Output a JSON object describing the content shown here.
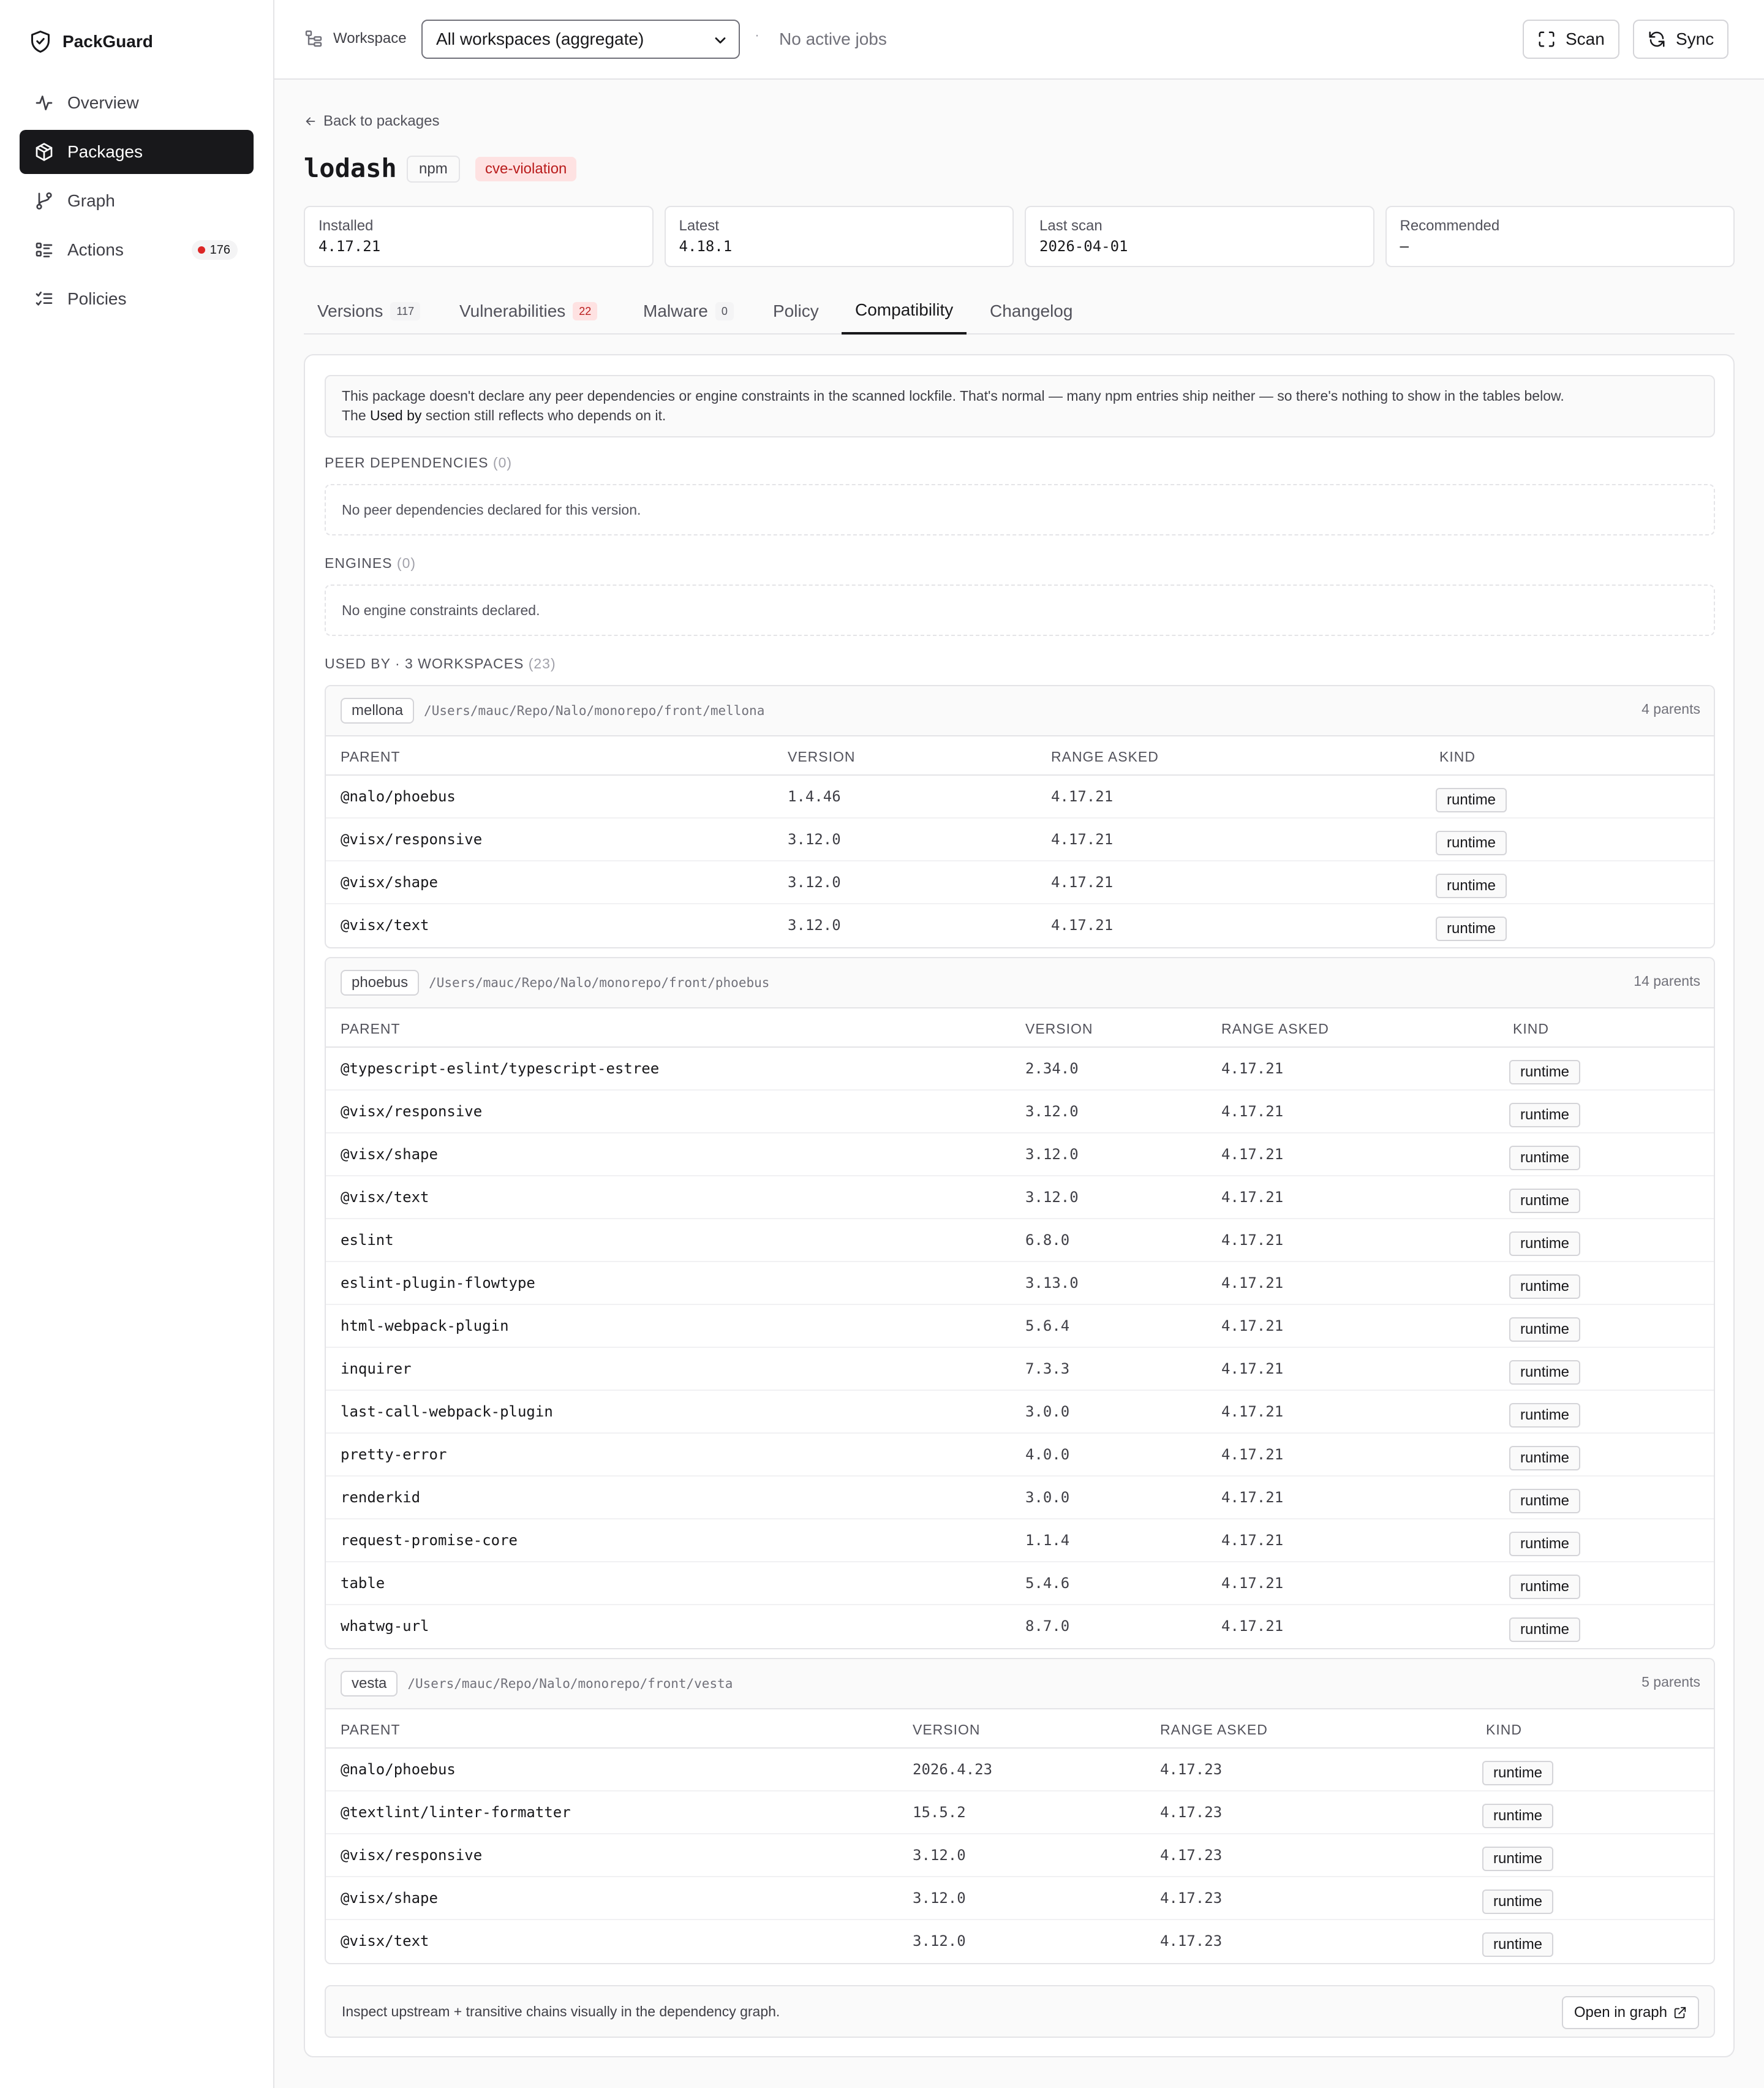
{
  "app": {
    "name": "PackGuard"
  },
  "sidebar": {
    "items": [
      {
        "label": "Overview",
        "icon": "activity-icon"
      },
      {
        "label": "Packages",
        "icon": "package-icon",
        "active": true
      },
      {
        "label": "Graph",
        "icon": "git-branch-icon"
      },
      {
        "label": "Actions",
        "icon": "list-checks-icon",
        "badge": "176"
      },
      {
        "label": "Policies",
        "icon": "list-todo-icon"
      }
    ]
  },
  "topbar": {
    "workspace_label": "Workspace",
    "workspace_selected": "All workspaces (aggregate)",
    "separator": "·",
    "jobs_status": "No active jobs",
    "scan_label": "Scan",
    "sync_label": "Sync"
  },
  "package": {
    "back_label": "Back to packages",
    "name": "lodash",
    "ecosystem": "npm",
    "status_badge": "cve-violation",
    "stats": [
      {
        "label": "Installed",
        "value": "4.17.21"
      },
      {
        "label": "Latest",
        "value": "4.18.1"
      },
      {
        "label": "Last scan",
        "value": "2026-04-01"
      },
      {
        "label": "Recommended",
        "value": "—"
      }
    ]
  },
  "tabs": [
    {
      "label": "Versions",
      "count": "117"
    },
    {
      "label": "Vulnerabilities",
      "count": "22"
    },
    {
      "label": "Malware",
      "count": "0"
    },
    {
      "label": "Policy"
    },
    {
      "label": "Compatibility",
      "active": true
    },
    {
      "label": "Changelog"
    }
  ],
  "compat": {
    "notice_line1": "This package doesn't declare any peer dependencies or engine constraints in the scanned lockfile. That's normal — many npm entries ship neither — so there's nothing to show in the tables below.",
    "notice_line2_pre": "The ",
    "notice_line2_bold": "Used by",
    "notice_line2_post": " section still reflects who depends on it.",
    "peer_label": "PEER DEPENDENCIES",
    "peer_count": "(0)",
    "peer_empty": "No peer dependencies declared for this version.",
    "engines_label": "ENGINES",
    "engines_count": "(0)",
    "engines_empty": "No engine constraints declared.",
    "used_by_label": "USED BY · 3 WORKSPACES",
    "used_by_count": "(23)",
    "columns": {
      "parent": "PARENT",
      "version": "VERSION",
      "range": "RANGE ASKED",
      "kind": "KIND"
    },
    "footer_text": "Inspect upstream + transitive chains visually in the dependency graph.",
    "open_graph_label": "Open in graph"
  },
  "workspaces": [
    {
      "name": "mellona",
      "path": "/Users/mauc/Repo/Nalo/monorepo/front/mellona",
      "parents_label": "4 parents",
      "rows": [
        {
          "parent": "@nalo/phoebus",
          "version": "1.4.46",
          "range": "4.17.21",
          "kind": "runtime"
        },
        {
          "parent": "@visx/responsive",
          "version": "3.12.0",
          "range": "4.17.21",
          "kind": "runtime"
        },
        {
          "parent": "@visx/shape",
          "version": "3.12.0",
          "range": "4.17.21",
          "kind": "runtime"
        },
        {
          "parent": "@visx/text",
          "version": "3.12.0",
          "range": "4.17.21",
          "kind": "runtime"
        }
      ]
    },
    {
      "name": "phoebus",
      "path": "/Users/mauc/Repo/Nalo/monorepo/front/phoebus",
      "parents_label": "14 parents",
      "rows": [
        {
          "parent": "@typescript-eslint/typescript-estree",
          "version": "2.34.0",
          "range": "4.17.21",
          "kind": "runtime"
        },
        {
          "parent": "@visx/responsive",
          "version": "3.12.0",
          "range": "4.17.21",
          "kind": "runtime"
        },
        {
          "parent": "@visx/shape",
          "version": "3.12.0",
          "range": "4.17.21",
          "kind": "runtime"
        },
        {
          "parent": "@visx/text",
          "version": "3.12.0",
          "range": "4.17.21",
          "kind": "runtime"
        },
        {
          "parent": "eslint",
          "version": "6.8.0",
          "range": "4.17.21",
          "kind": "runtime"
        },
        {
          "parent": "eslint-plugin-flowtype",
          "version": "3.13.0",
          "range": "4.17.21",
          "kind": "runtime"
        },
        {
          "parent": "html-webpack-plugin",
          "version": "5.6.4",
          "range": "4.17.21",
          "kind": "runtime"
        },
        {
          "parent": "inquirer",
          "version": "7.3.3",
          "range": "4.17.21",
          "kind": "runtime"
        },
        {
          "parent": "last-call-webpack-plugin",
          "version": "3.0.0",
          "range": "4.17.21",
          "kind": "runtime"
        },
        {
          "parent": "pretty-error",
          "version": "4.0.0",
          "range": "4.17.21",
          "kind": "runtime"
        },
        {
          "parent": "renderkid",
          "version": "3.0.0",
          "range": "4.17.21",
          "kind": "runtime"
        },
        {
          "parent": "request-promise-core",
          "version": "1.1.4",
          "range": "4.17.21",
          "kind": "runtime"
        },
        {
          "parent": "table",
          "version": "5.4.6",
          "range": "4.17.21",
          "kind": "runtime"
        },
        {
          "parent": "whatwg-url",
          "version": "8.7.0",
          "range": "4.17.21",
          "kind": "runtime"
        }
      ]
    },
    {
      "name": "vesta",
      "path": "/Users/mauc/Repo/Nalo/monorepo/front/vesta",
      "parents_label": "5 parents",
      "rows": [
        {
          "parent": "@nalo/phoebus",
          "version": "2026.4.23",
          "range": "4.17.23",
          "kind": "runtime"
        },
        {
          "parent": "@textlint/linter-formatter",
          "version": "15.5.2",
          "range": "4.17.23",
          "kind": "runtime"
        },
        {
          "parent": "@visx/responsive",
          "version": "3.12.0",
          "range": "4.17.23",
          "kind": "runtime"
        },
        {
          "parent": "@visx/shape",
          "version": "3.12.0",
          "range": "4.17.23",
          "kind": "runtime"
        },
        {
          "parent": "@visx/text",
          "version": "3.12.0",
          "range": "4.17.23",
          "kind": "runtime"
        }
      ]
    }
  ]
}
